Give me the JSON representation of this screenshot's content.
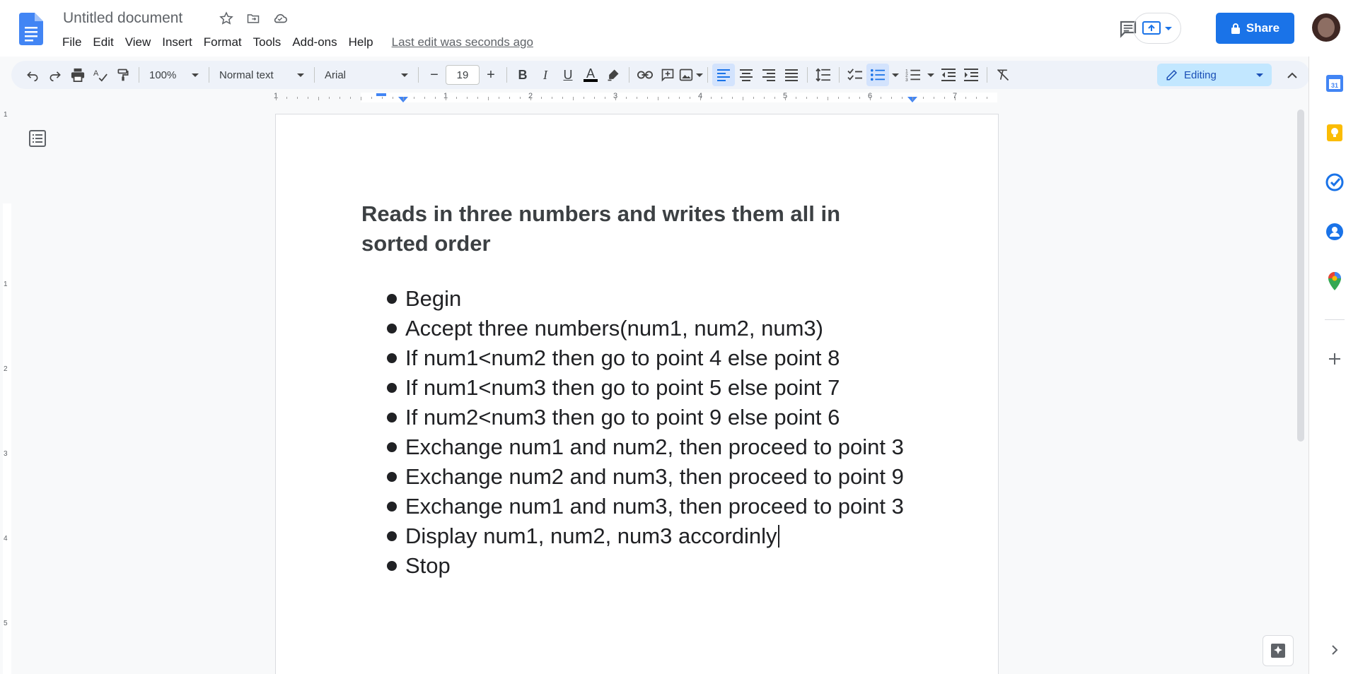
{
  "document": {
    "title": "Untitled document",
    "last_edit": "Last edit was seconds ago",
    "heading": "Reads in three numbers and writes them all in sorted order",
    "list_items": [
      "Begin",
      "Accept three numbers(num1, num2, num3)",
      "If num1<num2 then go to point 4 else point 8",
      "If num1<num3 then go to point 5 else point 7",
      "If num2<num3 then go to point 9 else point 6",
      "Exchange num1 and num2, then proceed to point 3",
      "Exchange num2 and num3, then proceed to point 9",
      "Exchange num1 and num3, then proceed to point 3",
      "Display num1, num2, num3 accordinly",
      "Stop"
    ]
  },
  "menu": [
    "File",
    "Edit",
    "View",
    "Insert",
    "Format",
    "Tools",
    "Add-ons",
    "Help"
  ],
  "header": {
    "share_label": "Share"
  },
  "toolbar": {
    "zoom": "100%",
    "style": "Normal text",
    "font": "Arial",
    "font_size": "19",
    "minus": "−",
    "plus": "+",
    "bold": "B",
    "italic": "I",
    "underline": "U",
    "text_color": "A",
    "mode": "Editing"
  },
  "ruler": {
    "top_numbers": [
      "1",
      "1",
      "2",
      "3",
      "4",
      "5",
      "6",
      "7"
    ],
    "left_numbers": [
      "1",
      "1",
      "2",
      "3",
      "4",
      "5"
    ]
  },
  "icons": {
    "docs_logo": "docs-logo-icon",
    "star": "star-icon",
    "move": "folder-move-icon",
    "cloud": "cloud-status-icon",
    "comments": "comments-icon",
    "present": "present-icon",
    "lock": "lock-icon",
    "outline": "outline-icon",
    "explore": "explore-icon"
  },
  "colors": {
    "accent": "#1a73e8",
    "toolbar_bg": "#eef2f9",
    "editing_bg": "#c2e7ff"
  }
}
